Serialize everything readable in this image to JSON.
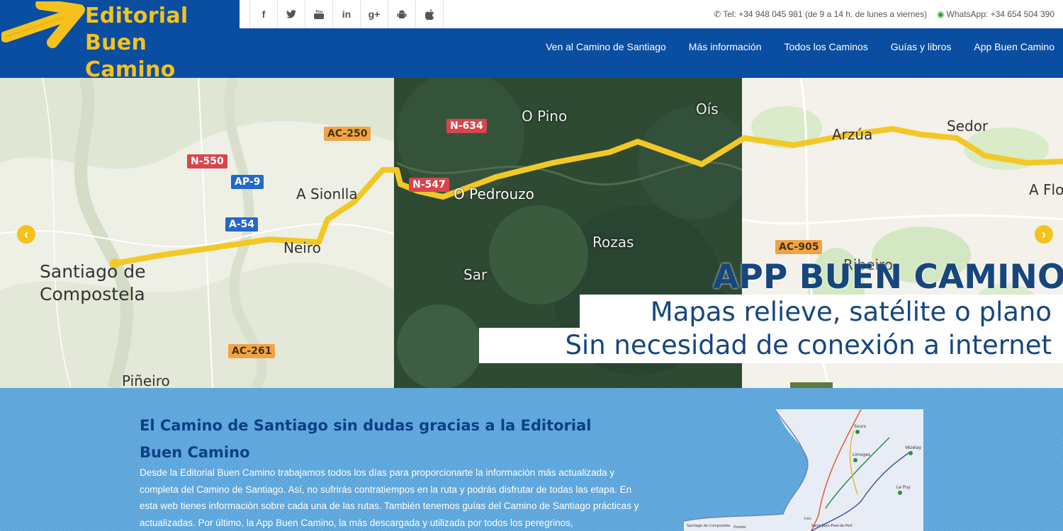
{
  "brand": {
    "line1": "Editorial",
    "line2": "Buen Camino",
    "accent": "#f5c21d"
  },
  "topbar": {
    "socials": [
      {
        "icon": "facebook-icon",
        "glyph": "f"
      },
      {
        "icon": "twitter-icon",
        "glyph": "🐦"
      },
      {
        "icon": "youtube-icon",
        "glyph": "▶"
      },
      {
        "icon": "linkedin-icon",
        "glyph": "in"
      },
      {
        "icon": "google-plus-icon",
        "glyph": "g+"
      },
      {
        "icon": "android-icon",
        "glyph": "🤖"
      },
      {
        "icon": "apple-icon",
        "glyph": ""
      }
    ],
    "phone": "Tel: +34 948 045 981 (de 9 a 14 h. de lunes a viernes)",
    "whatsapp": "WhatsApp: +34 654 504 390"
  },
  "nav": {
    "items": [
      "Ven al Camino de Santiago",
      "Más información",
      "Todos los Caminos",
      "Guías y libros",
      "App Buen Camino"
    ]
  },
  "hero": {
    "places": {
      "santiago": "Santiago de\nCompostela",
      "neiro": "Neiro",
      "sionlla": "A Sionlla",
      "pineiro": "Piñeiro",
      "opino": "O Pino",
      "ois": "Oís",
      "opedrouzo": "O Pedrouzo",
      "rozas": "Rozas",
      "sar": "Sar",
      "arzua": "Arzúa",
      "sedor": "Sedor",
      "aflo": "A Flo",
      "ribe": "Ribeiro"
    },
    "roads": {
      "n550": "N-550",
      "ap9": "AP-9",
      "a54": "A-54",
      "ac250": "AC-250",
      "ac261": "AC-261",
      "n634": "N-634",
      "n547": "N-547",
      "ac905": "AC-905"
    },
    "promo_title": "APP BUEN CAMINO",
    "promo_line1": "Mapas relieve, satélite o plano",
    "promo_line2": "Sin necesidad de conexión a internet",
    "prev_icon": "chevron-left-icon",
    "next_icon": "chevron-right-icon"
  },
  "intro": {
    "heading": "El Camino de Santiago sin dudas gracias a la Editorial Buen Camino",
    "body": "Desde la Editorial Buen Camino trabajamos todos los días para proporcionarte la información más actualizada y completa del Camino de Santiago. Así, no sufrirás contratiempos en la ruta y podrás disfrutar de todas las etapa. En esta web tienes información sobre cada una de las rutas. También tenemos guías del Camino de Santiago prácticas y actualizadas. Por último, la App Buen Camino, la más descargada y utilizada por todos los peregrinos,"
  },
  "minimap": {
    "labels": [
      "Vézelay",
      "Sours",
      "Limoges",
      "Le Puy",
      "Saint-Jean-Pied-de-Port",
      "Oviedo",
      "Santiago de Compostela",
      "Irún"
    ]
  }
}
